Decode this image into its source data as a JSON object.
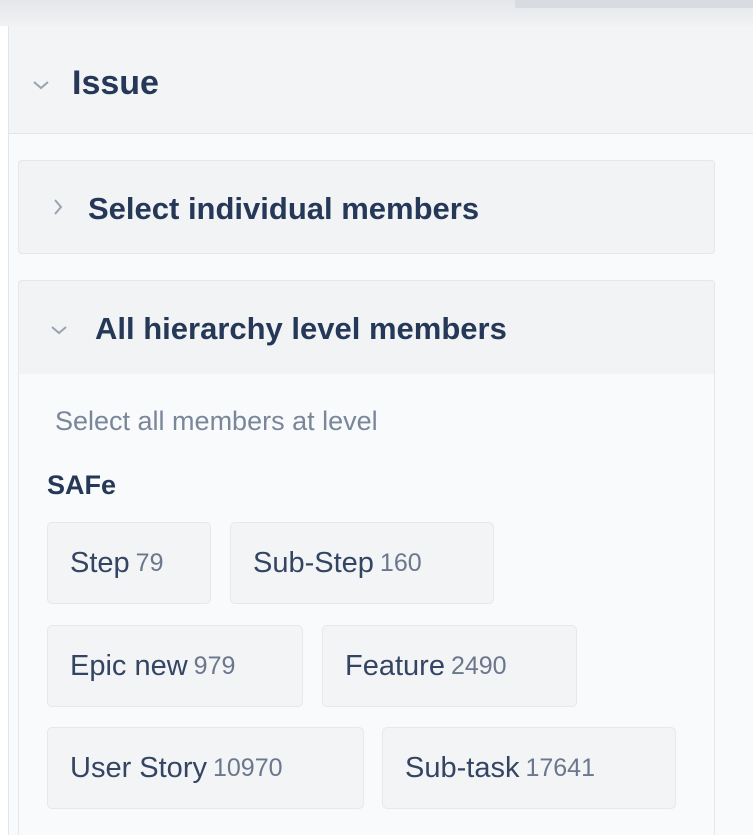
{
  "panel": {
    "title": "Issue"
  },
  "sections": {
    "individual": {
      "title": "Select individual members"
    },
    "hierarchy": {
      "title": "All hierarchy level members",
      "hint": "Select all members at level",
      "level_name": "SAFe",
      "chips": [
        {
          "name": "Step",
          "count": "79"
        },
        {
          "name": "Sub-Step",
          "count": "160"
        },
        {
          "name": "Epic new",
          "count": "979"
        },
        {
          "name": "Feature",
          "count": "2490"
        },
        {
          "name": "User Story",
          "count": "10970"
        },
        {
          "name": "Sub-task",
          "count": "17641"
        }
      ]
    }
  },
  "icons": {
    "collapse": "chevron-down-icon",
    "expand": "chevron-right-icon"
  }
}
